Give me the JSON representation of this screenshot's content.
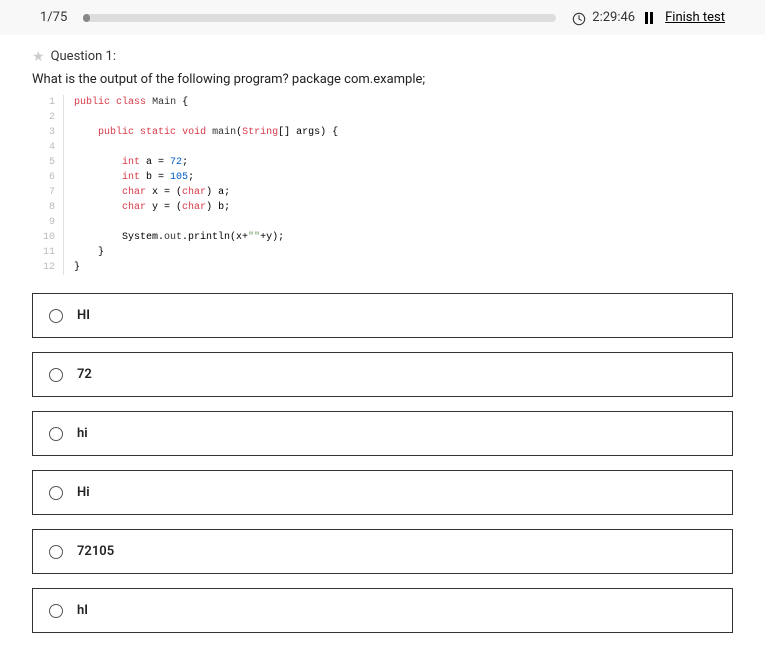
{
  "header": {
    "progress_text": "1/75",
    "timer": "2:29:46",
    "finish_label": "Finish test"
  },
  "question": {
    "label": "Question 1:",
    "prompt": "What is the output of the following program? package com.example;"
  },
  "code": {
    "lines": [
      "public class Main {",
      "",
      "    public static void main(String[] args) {",
      "",
      "        int a = 72;",
      "        int b = 105;",
      "        char x = (char) a;",
      "        char y = (char) b;",
      "",
      "        System.out.println(x+\"\"+y);",
      "    }",
      "}"
    ]
  },
  "options": [
    {
      "label": "HI"
    },
    {
      "label": "72"
    },
    {
      "label": "hi"
    },
    {
      "label": "Hi"
    },
    {
      "label": "72105"
    },
    {
      "label": "hI"
    }
  ]
}
